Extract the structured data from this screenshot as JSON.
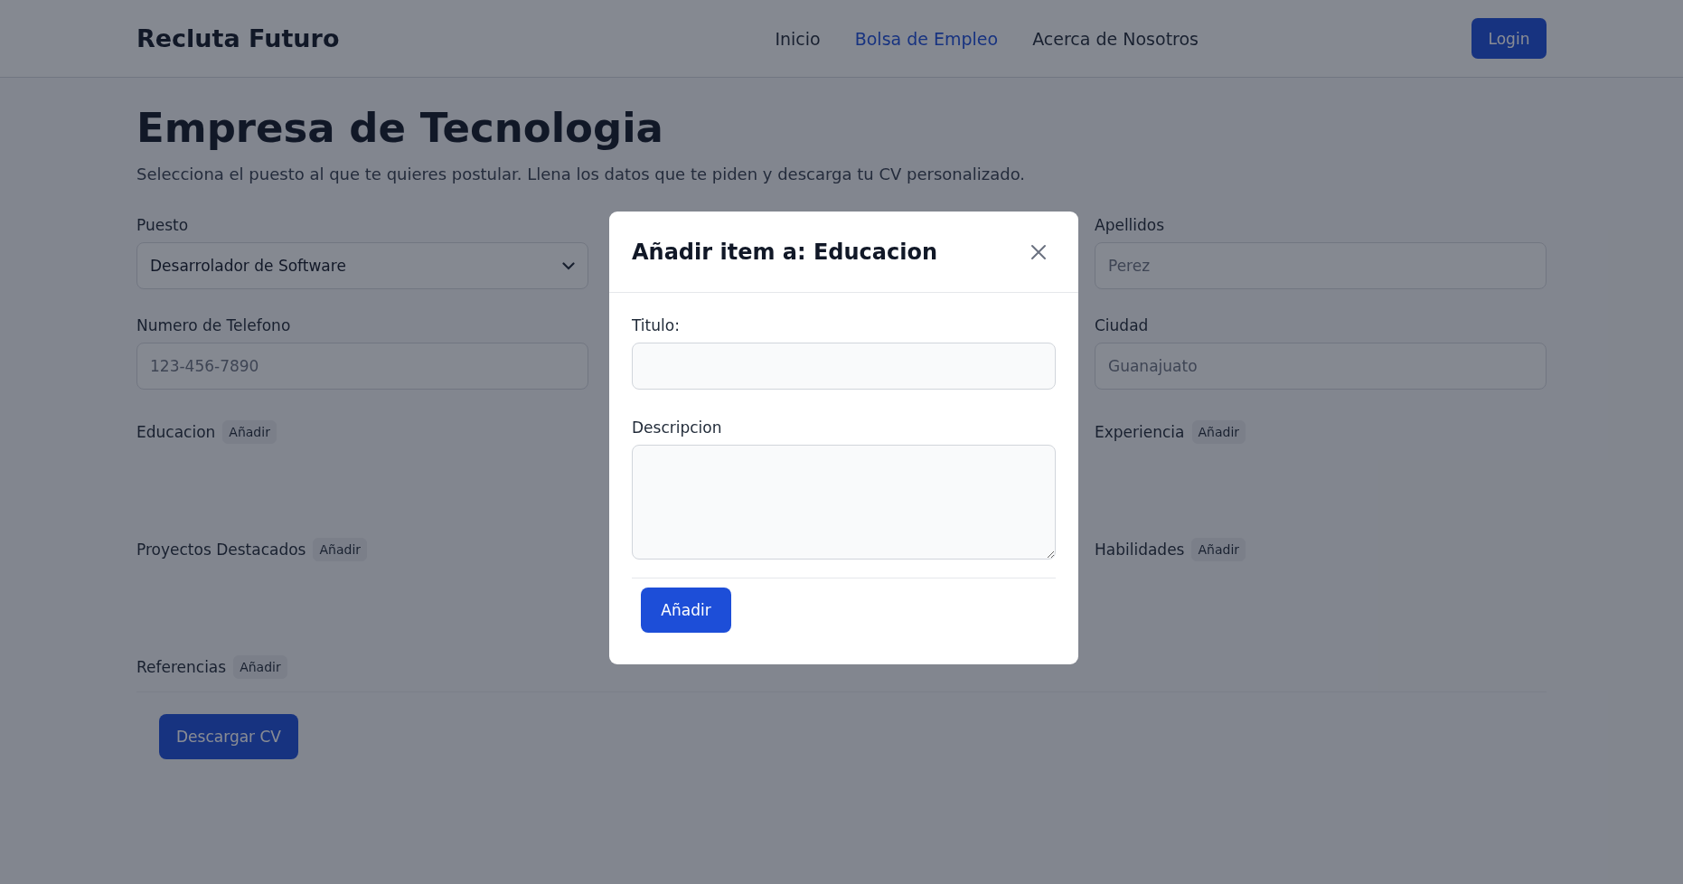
{
  "navbar": {
    "brand": "Recluta Futuro",
    "links": [
      {
        "label": "Inicio",
        "selected": false
      },
      {
        "label": "Bolsa de Empleo",
        "selected": true
      },
      {
        "label": "Acerca de Nosotros",
        "selected": false
      }
    ],
    "login_button": "Login"
  },
  "page": {
    "title": "Empresa de Tecnologia",
    "subtitle": "Selecciona el puesto al que te quieres postular. Llena los datos que te piden y descarga tu CV personalizado."
  },
  "form": {
    "field_rows": [
      {
        "left": {
          "label": "Puesto",
          "kind": "select",
          "value": "Desarrolador de Software"
        },
        "right": {
          "label": "Apellidos",
          "kind": "input",
          "placeholder": "Perez"
        }
      },
      {
        "left": {
          "label": "Numero de Telefono",
          "kind": "input",
          "placeholder": "123-456-7890"
        },
        "right": {
          "label": "Ciudad",
          "kind": "input",
          "placeholder": "Guanajuato"
        }
      }
    ],
    "section_rows": [
      {
        "left": {
          "label": "Educacion",
          "button": "Añadir"
        },
        "right": {
          "label": "Experiencia",
          "button": "Añadir"
        }
      },
      {
        "left": {
          "label": "Proyectos Destacados",
          "button": "Añadir"
        },
        "right": {
          "label": "Habilidades",
          "button": "Añadir"
        }
      }
    ],
    "bottom_section": {
      "label": "Referencias",
      "button": "Añadir"
    },
    "download_button": "Descargar CV"
  },
  "modal": {
    "title": "Añadir item a: Educacion",
    "fields": [
      {
        "label": "Titulo:",
        "kind": "input"
      },
      {
        "label": "Descripcion",
        "kind": "textarea"
      }
    ],
    "submit_button": "Añadir"
  }
}
